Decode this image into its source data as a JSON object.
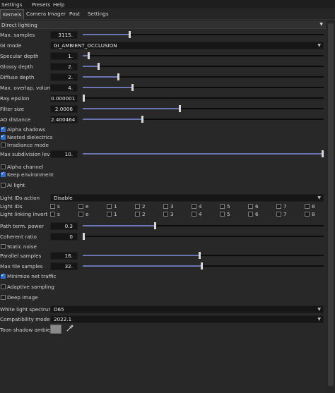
{
  "menu": [
    "Settings",
    "Presets",
    "Help"
  ],
  "tabs": [
    "Kernels",
    "Camera Imager",
    "Post",
    "Settings"
  ],
  "section_title": "Direct lighting",
  "sliders": [
    {
      "label": "Max. samples",
      "value": "3115.",
      "level": 0.194
    },
    {
      "label": "Specular depth",
      "value": "1.",
      "level": 0.022
    },
    {
      "label": "Glossy depth",
      "value": "2.",
      "level": 0.064
    },
    {
      "label": "Diffuse depth",
      "value": "2.",
      "level": 0.146
    },
    {
      "label": "Max. overlap. volumes",
      "value": "4.",
      "level": 0.204
    },
    {
      "label": "Ray epsilon",
      "value": "0.000001",
      "level": 0.0
    },
    {
      "label": "Filter size",
      "value": "2.0006",
      "level": 0.403
    },
    {
      "label": "AO distance",
      "value": "2.400464",
      "level": 0.245
    }
  ],
  "gi_mode": {
    "label": "GI mode",
    "value": "GI_AMBIENT_OCCLUSION"
  },
  "checks_a": [
    {
      "label": "Alpha shadows",
      "checked": true
    },
    {
      "label": "Nested dielectrics",
      "checked": true
    },
    {
      "label": "Irradiance mode",
      "checked": false
    }
  ],
  "subdiv": {
    "label": "Max subdivision level",
    "value": "10.",
    "level": 1.0
  },
  "checks_b": [
    {
      "label": "Alpha channel",
      "checked": false
    },
    {
      "label": "Keep environment",
      "checked": true
    },
    {
      "label": "AI light",
      "checked": false
    }
  ],
  "light_ids_action": {
    "label": "Light IDs action",
    "value": "Disable"
  },
  "light_ids": {
    "label": "Light IDs",
    "items": [
      "s",
      "e",
      "1",
      "2",
      "3",
      "4",
      "5",
      "6",
      "7",
      "8"
    ]
  },
  "light_linking_invert": {
    "label": "Light linking invert",
    "items": [
      "s",
      "e",
      "1",
      "2",
      "3",
      "4",
      "5",
      "6",
      "7",
      "8"
    ]
  },
  "path_term": {
    "label": "Path term. power",
    "value": "0.3",
    "level": 0.298
  },
  "coherent": {
    "label": "Coherent ratio",
    "value": "0",
    "level": 0.0
  },
  "static_noise": {
    "label": "Static noise",
    "checked": false
  },
  "parallel": {
    "label": "Parallel samples",
    "value": "16.",
    "level": 0.484
  },
  "max_tile": {
    "label": "Max tile samples",
    "value": "32.",
    "level": 0.492
  },
  "minimize_net": {
    "label": "Minimize net traffic",
    "checked": true
  },
  "adaptive": {
    "label": "Adaptive sampling",
    "checked": false
  },
  "deep": {
    "label": "Deep image",
    "checked": false
  },
  "white_light": {
    "label": "White light spectrum",
    "value": "D65"
  },
  "compat": {
    "label": "Compatibility mode",
    "value": "2022.1"
  },
  "toon": {
    "label": "Toon shadow ambient",
    "color": "#8a8a8a",
    "picker_icon": "eyedropper-icon"
  }
}
